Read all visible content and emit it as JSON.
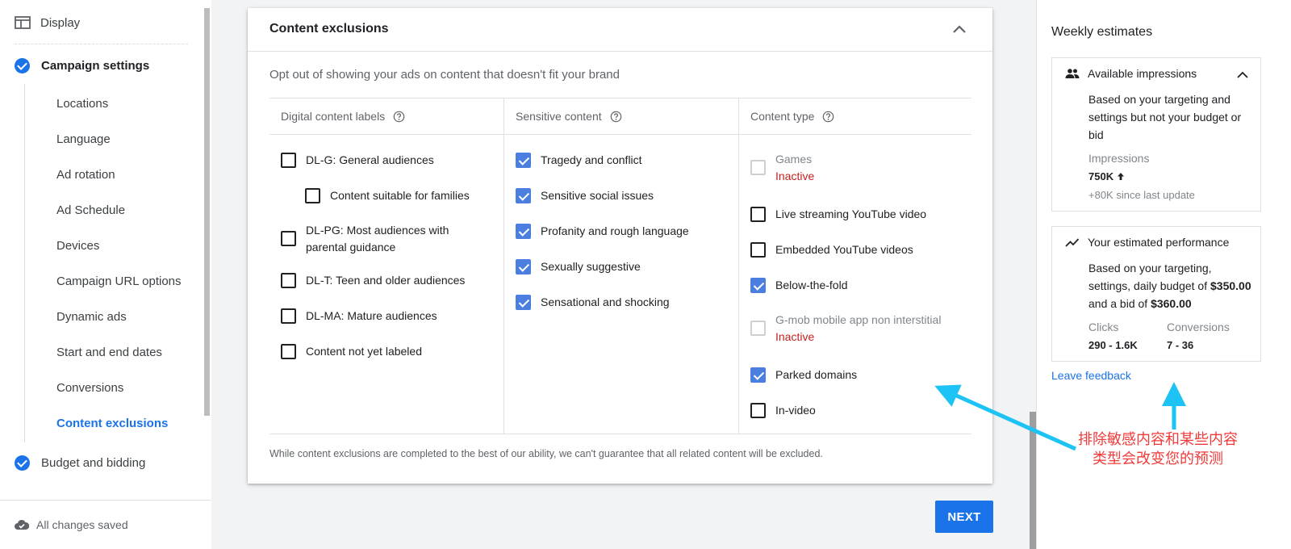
{
  "sidebar": {
    "display_label": "Display",
    "campaign_settings_label": "Campaign settings",
    "items": [
      {
        "label": "Locations",
        "active": false
      },
      {
        "label": "Language",
        "active": false
      },
      {
        "label": "Ad rotation",
        "active": false
      },
      {
        "label": "Ad Schedule",
        "active": false
      },
      {
        "label": "Devices",
        "active": false
      },
      {
        "label": "Campaign URL options",
        "active": false
      },
      {
        "label": "Dynamic ads",
        "active": false
      },
      {
        "label": "Start and end dates",
        "active": false
      },
      {
        "label": "Conversions",
        "active": false
      },
      {
        "label": "Content exclusions",
        "active": true
      }
    ],
    "budget_label": "Budget and bidding",
    "saved_status": "All changes saved"
  },
  "card": {
    "title": "Content exclusions",
    "subtitle": "Opt out of showing your ads on content that doesn't fit your brand",
    "footer": "While content exclusions are completed to the best of our ability, we can't guarantee that all related content will be excluded.",
    "columns": [
      {
        "header": "Digital content labels",
        "options": [
          {
            "label": "DL-G: General audiences",
            "checked": false
          },
          {
            "label": "Content suitable for families",
            "checked": false
          },
          {
            "label": "DL-PG: Most audiences with parental guidance",
            "checked": false
          },
          {
            "label": "DL-T: Teen and older audiences",
            "checked": false
          },
          {
            "label": "DL-MA: Mature audiences",
            "checked": false
          },
          {
            "label": "Content not yet labeled",
            "checked": false
          }
        ]
      },
      {
        "header": "Sensitive content",
        "options": [
          {
            "label": "Tragedy and conflict",
            "checked": true
          },
          {
            "label": "Sensitive social issues",
            "checked": true
          },
          {
            "label": "Profanity and rough language",
            "checked": true
          },
          {
            "label": "Sexually suggestive",
            "checked": true
          },
          {
            "label": "Sensational and shocking",
            "checked": true
          }
        ]
      },
      {
        "header": "Content type",
        "options": [
          {
            "label": "Games",
            "checked": false,
            "disabled": true,
            "status": "Inactive"
          },
          {
            "label": "Live streaming YouTube video",
            "checked": false
          },
          {
            "label": "Embedded YouTube videos",
            "checked": false
          },
          {
            "label": "Below-the-fold",
            "checked": true
          },
          {
            "label": "G-mob mobile app non interstitial",
            "checked": false,
            "disabled": true,
            "status": "Inactive"
          },
          {
            "label": "Parked domains",
            "checked": true
          },
          {
            "label": "In-video",
            "checked": false
          }
        ]
      }
    ]
  },
  "next_label": "NEXT",
  "estimates": {
    "title": "Weekly estimates",
    "impressions_card": {
      "title": "Available impressions",
      "description": "Based on your targeting and settings but not your budget or bid",
      "metric_label": "Impressions",
      "metric_value": "750K",
      "metric_delta": "+80K since last update"
    },
    "performance_card": {
      "title": "Your estimated performance",
      "desc_prefix": "Based on your targeting, settings, daily budget of",
      "budget": "$350.00",
      "desc_mid": "and a bid of",
      "bid": "$360.00",
      "clicks_label": "Clicks",
      "clicks_value": "290 - 1.6K",
      "conversions_label": "Conversions",
      "conversions_value": "7 - 36"
    },
    "feedback_label": "Leave feedback"
  },
  "annotation": {
    "text": "排除敏感内容和某些内容类型会改变您的预测",
    "color": "#f03a3a",
    "arrow_color": "#1ec3f5"
  },
  "colors": {
    "accent": "#1a73e8",
    "checkbox_checked": "#4a7fe0",
    "inactive": "#c5221f"
  }
}
